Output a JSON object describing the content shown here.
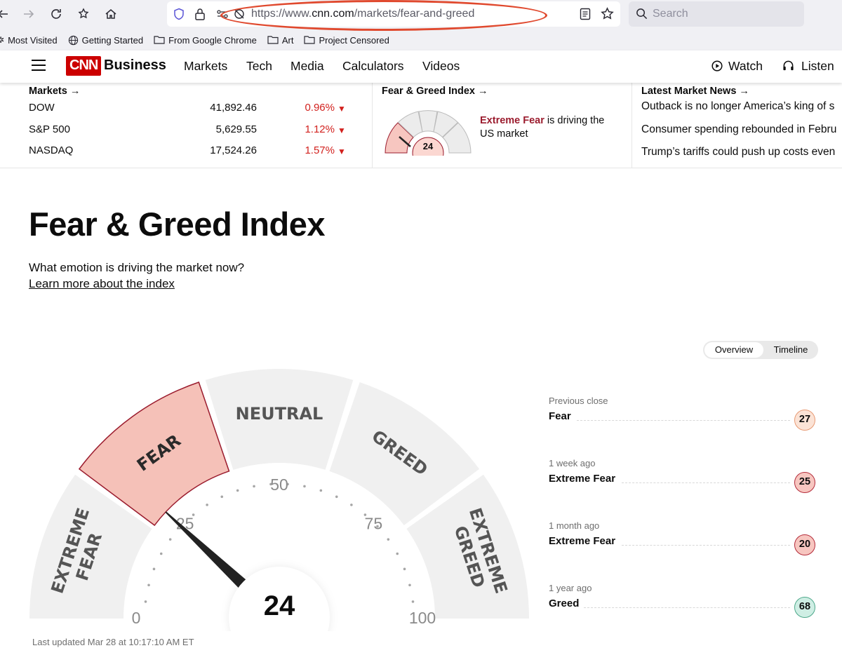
{
  "browser": {
    "url_prefix": "https://www.",
    "url_host": "cnn.com",
    "url_path": "/markets/fear-and-greed",
    "search_placeholder": "Search",
    "bookmarks": [
      "Most Visited",
      "Getting Started",
      "From Google Chrome",
      "Art",
      "Project Censored"
    ]
  },
  "nav": {
    "logo": "CNN",
    "section": "Business",
    "links": [
      "Markets",
      "Tech",
      "Media",
      "Calculators",
      "Videos"
    ],
    "watch": "Watch",
    "listen": "Listen"
  },
  "ticker": {
    "markets_heading": "Markets →",
    "rows": [
      {
        "name": "DOW",
        "value": "41,892.46",
        "change": "0.96%"
      },
      {
        "name": "S&P 500",
        "value": "5,629.55",
        "change": "1.12%"
      },
      {
        "name": "NASDAQ",
        "value": "17,524.26",
        "change": "1.57%"
      }
    ],
    "fg_heading": "Fear & Greed Index →",
    "fg_value": "24",
    "fg_label": "Extreme Fear",
    "fg_text": " is driving the",
    "fg_text2": "US market",
    "news_heading": "Latest Market News →",
    "news": [
      "Outback is no longer America’s king of s",
      "Consumer spending rebounded in Febru",
      "Trump’s tariffs could push up costs even"
    ]
  },
  "main": {
    "title": "Fear & Greed Index",
    "subtitle": "What emotion is driving the market now?",
    "learn_more": "Learn more about the index",
    "tabs": [
      "Overview",
      "Timeline"
    ],
    "gauge": {
      "value": 24,
      "value_text": "24",
      "segments": [
        "EXTREME FEAR",
        "FEAR",
        "NEUTRAL",
        "GREED",
        "EXTREME GREED"
      ],
      "ticks": [
        "0",
        "25",
        "50",
        "75",
        "100"
      ]
    },
    "history": [
      {
        "label": "Previous close",
        "rating": "Fear",
        "value": "27",
        "color": "#fbe3d6",
        "border": "#e89a74"
      },
      {
        "label": "1 week ago",
        "rating": "Extreme Fear",
        "value": "25",
        "color": "#f7c6c0",
        "border": "#b42b3a"
      },
      {
        "label": "1 month ago",
        "rating": "Extreme Fear",
        "value": "20",
        "color": "#f7c6c0",
        "border": "#b42b3a"
      },
      {
        "label": "1 year ago",
        "rating": "Greed",
        "value": "68",
        "color": "#cfeee4",
        "border": "#4da88a"
      }
    ],
    "last_updated": "Last updated Mar 28 at 10:17:10 AM ET"
  },
  "colors": {
    "extreme_fear_fill": "#f5c1b8",
    "extreme_fear_border": "#9b1c2e",
    "segment_gray": "#f0f0f0",
    "cnn_red": "#cc0000",
    "down_red": "#d2211e",
    "annotation_red": "#e0492e"
  }
}
